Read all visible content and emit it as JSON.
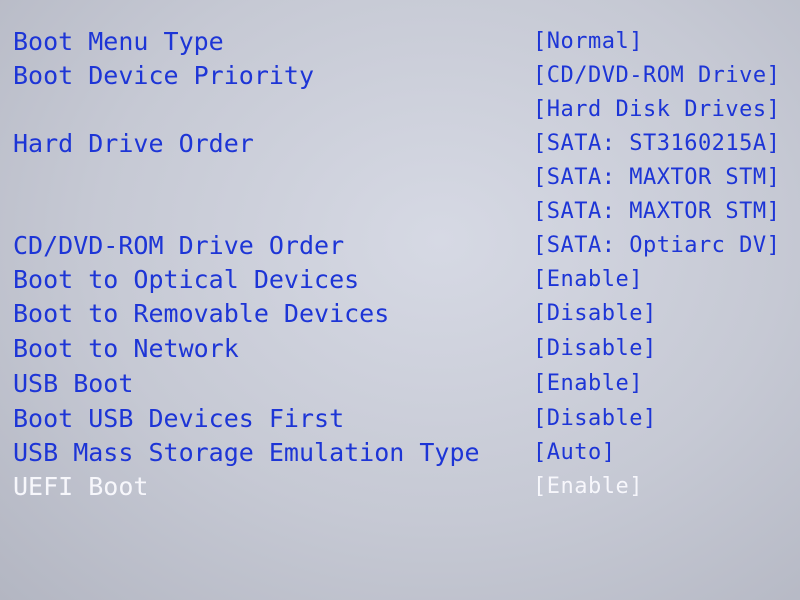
{
  "boot_menu": {
    "items": [
      {
        "label": "Boot Menu Type",
        "value": "[Normal]"
      },
      {
        "label": "Boot Device Priority",
        "value": "[CD/DVD-ROM Drive]"
      },
      {
        "label": "",
        "value": "[Hard Disk Drives]"
      },
      {
        "label": "Hard Drive Order",
        "value": "[SATA: ST3160215A]"
      },
      {
        "label": "",
        "value": "[SATA: MAXTOR STM]"
      },
      {
        "label": "",
        "value": "[SATA: MAXTOR STM]"
      },
      {
        "label": "CD/DVD-ROM Drive Order",
        "value": "[SATA: Optiarc DV]"
      },
      {
        "label": "Boot to Optical Devices",
        "value": "[Enable]"
      },
      {
        "label": "Boot to Removable Devices",
        "value": "[Disable]"
      },
      {
        "label": "Boot to Network",
        "value": "[Disable]"
      },
      {
        "label": "USB Boot",
        "value": "[Enable]"
      },
      {
        "label": "Boot USB Devices First",
        "value": "[Disable]"
      },
      {
        "label": "USB Mass Storage Emulation Type",
        "value": "[Auto]"
      },
      {
        "label": "UEFI Boot",
        "value": "[Enable]"
      }
    ],
    "selected_item": "UEFI Boot"
  },
  "colors": {
    "background": "#c9ccd7",
    "text": "#1d35d6",
    "selected_text": "#f7f7fb"
  }
}
